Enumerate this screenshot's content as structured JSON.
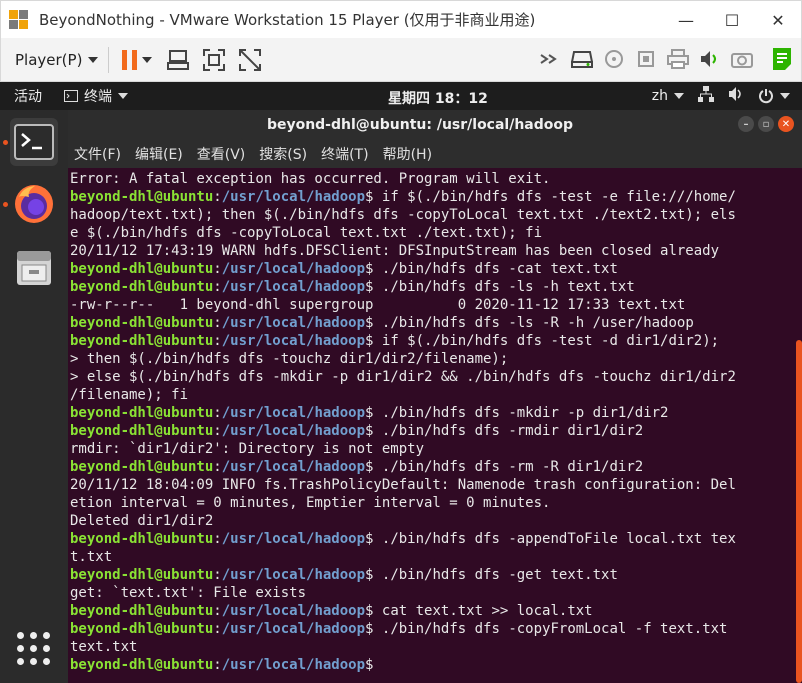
{
  "window": {
    "title": "BeyondNothing - VMware Workstation 15 Player (仅用于非商业用途)",
    "minimize": "—",
    "maximize": "☐",
    "close": "✕"
  },
  "vm_toolbar": {
    "player_menu": "Player(P)"
  },
  "topbar": {
    "activities": "活动",
    "app_menu": "终端",
    "clock": "星期四 18：12",
    "input_method": "zh"
  },
  "terminal": {
    "title": "beyond-dhl@ubuntu: /usr/local/hadoop",
    "menu": [
      "文件(F)",
      "编辑(E)",
      "查看(V)",
      "搜索(S)",
      "终端(T)",
      "帮助(H)"
    ],
    "prompt": {
      "user": "beyond-dhl@ubuntu",
      "sep": ":",
      "path": "/usr/local/hadoop",
      "dollar": "$"
    },
    "lines": [
      {
        "type": "out",
        "text": "Error: A fatal exception has occurred. Program will exit."
      },
      {
        "type": "prompt",
        "cmd": " if $(./bin/hdfs dfs -test -e file:///home/"
      },
      {
        "type": "out",
        "text": "hadoop/text.txt); then $(./bin/hdfs dfs -copyToLocal text.txt ./text2.txt); els"
      },
      {
        "type": "out",
        "text": "e $(./bin/hdfs dfs -copyToLocal text.txt ./text.txt); fi"
      },
      {
        "type": "out",
        "text": "20/11/12 17:43:19 WARN hdfs.DFSClient: DFSInputStream has been closed already"
      },
      {
        "type": "prompt",
        "cmd": " ./bin/hdfs dfs -cat text.txt"
      },
      {
        "type": "prompt",
        "cmd": " ./bin/hdfs dfs -ls -h text.txt"
      },
      {
        "type": "out",
        "text": "-rw-r--r--   1 beyond-dhl supergroup          0 2020-11-12 17:33 text.txt"
      },
      {
        "type": "prompt",
        "cmd": " ./bin/hdfs dfs -ls -R -h /user/hadoop"
      },
      {
        "type": "prompt",
        "cmd": " if $(./bin/hdfs dfs -test -d dir1/dir2);"
      },
      {
        "type": "out",
        "text": "> then $(./bin/hdfs dfs -touchz dir1/dir2/filename);"
      },
      {
        "type": "out",
        "text": "> else $(./bin/hdfs dfs -mkdir -p dir1/dir2 && ./bin/hdfs dfs -touchz dir1/dir2"
      },
      {
        "type": "out",
        "text": "/filename); fi"
      },
      {
        "type": "prompt",
        "cmd": " ./bin/hdfs dfs -mkdir -p dir1/dir2"
      },
      {
        "type": "prompt",
        "cmd": " ./bin/hdfs dfs -rmdir dir1/dir2"
      },
      {
        "type": "out",
        "text": "rmdir: `dir1/dir2': Directory is not empty"
      },
      {
        "type": "prompt",
        "cmd": " ./bin/hdfs dfs -rm -R dir1/dir2"
      },
      {
        "type": "out",
        "text": "20/11/12 18:04:09 INFO fs.TrashPolicyDefault: Namenode trash configuration: Del"
      },
      {
        "type": "out",
        "text": "etion interval = 0 minutes, Emptier interval = 0 minutes."
      },
      {
        "type": "out",
        "text": "Deleted dir1/dir2"
      },
      {
        "type": "prompt",
        "cmd": " ./bin/hdfs dfs -appendToFile local.txt tex"
      },
      {
        "type": "out",
        "text": "t.txt"
      },
      {
        "type": "prompt",
        "cmd": " ./bin/hdfs dfs -get text.txt"
      },
      {
        "type": "out",
        "text": "get: `text.txt': File exists"
      },
      {
        "type": "prompt",
        "cmd": " cat text.txt >> local.txt"
      },
      {
        "type": "prompt",
        "cmd": " ./bin/hdfs dfs -copyFromLocal -f text.txt"
      },
      {
        "type": "out",
        "text": "text.txt"
      },
      {
        "type": "prompt",
        "cmd": ""
      }
    ]
  }
}
